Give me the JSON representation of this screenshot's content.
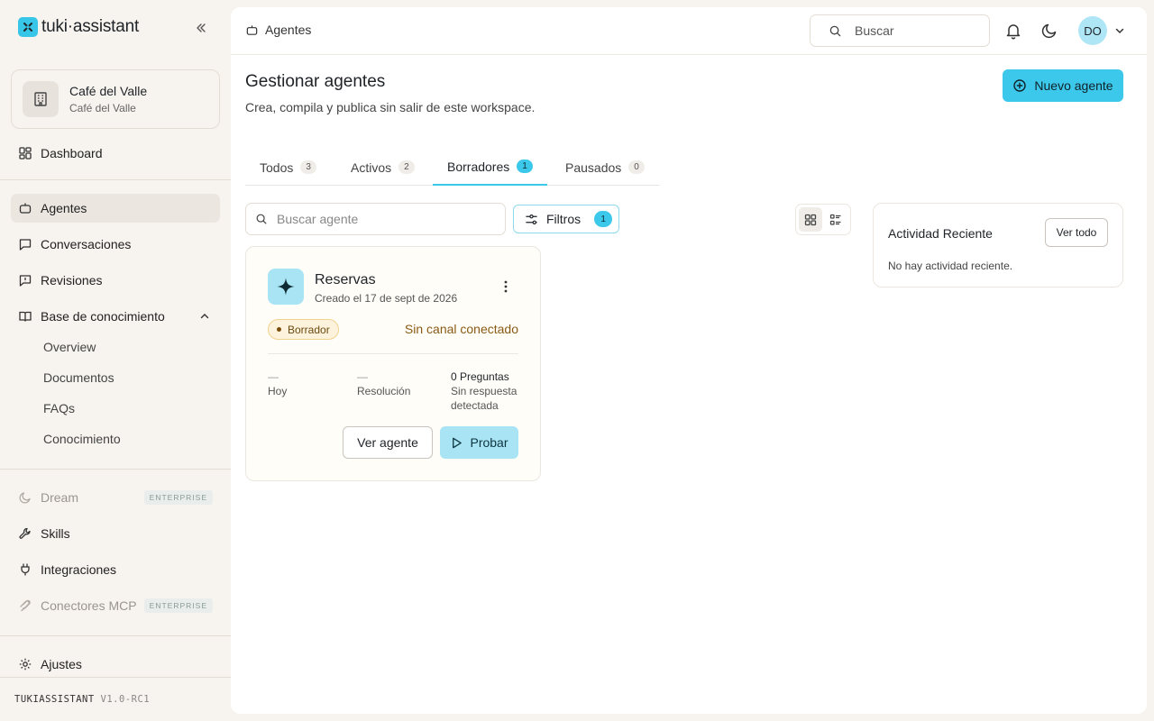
{
  "brand": {
    "name": "tuki·assistant"
  },
  "workspace": {
    "name": "Café del Valle",
    "subtitle": "Café del Valle"
  },
  "sidebar": {
    "dashboard": "Dashboard",
    "items": [
      {
        "label": "Agentes",
        "icon": "bot-icon",
        "active": true
      },
      {
        "label": "Conversaciones",
        "icon": "chat-icon"
      },
      {
        "label": "Revisiones",
        "icon": "review-icon"
      },
      {
        "label": "Base de conocimiento",
        "icon": "book-icon"
      }
    ],
    "kb_subitems": [
      "Overview",
      "Documentos",
      "FAQs",
      "Conocimiento"
    ],
    "lower": [
      {
        "label": "Dream",
        "badge": "ENTERPRISE",
        "disabled": true
      },
      {
        "label": "Skills"
      },
      {
        "label": "Integraciones"
      },
      {
        "label": "Conectores MCP",
        "badge": "ENTERPRISE",
        "disabled": true
      }
    ],
    "settings": "Ajustes",
    "version_name": "TUKIASSISTANT",
    "version": "V1.0-RC1"
  },
  "header": {
    "breadcrumb": "Agentes",
    "search_placeholder": "Buscar",
    "avatar_initials": "DO"
  },
  "page": {
    "title": "Gestionar agentes",
    "subtitle": "Crea, compila y publica sin salir de este workspace.",
    "new_button": "Nuevo agente"
  },
  "tabs": [
    {
      "label": "Todos",
      "count": "3"
    },
    {
      "label": "Activos",
      "count": "2"
    },
    {
      "label": "Borradores",
      "count": "1",
      "active": true
    },
    {
      "label": "Pausados",
      "count": "0"
    }
  ],
  "toolbar": {
    "search_placeholder": "Buscar agente",
    "filters_label": "Filtros",
    "filters_count": "1"
  },
  "agent": {
    "name": "Reservas",
    "created": "Creado el 17 de sept de 2026",
    "status": "Borrador",
    "channel": "Sin canal conectado",
    "stats": [
      {
        "value": "—",
        "label": "Hoy"
      },
      {
        "value": "—",
        "label": "Resolución"
      },
      {
        "value": "0 Preguntas",
        "label": "Sin respuesta detectada"
      }
    ],
    "view_button": "Ver agente",
    "try_button": "Probar"
  },
  "activity": {
    "title": "Actividad Reciente",
    "button": "Ver todo",
    "empty": "No hay actividad reciente."
  },
  "colors": {
    "accent": "#3cc8ea",
    "accent_soft": "#a9e4f4",
    "draft": "#fdf3dc"
  }
}
